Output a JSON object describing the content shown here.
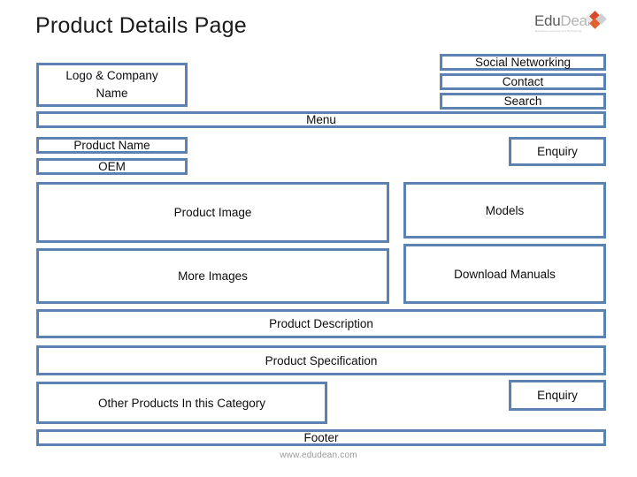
{
  "page": {
    "title": "Product Details Page",
    "footer_url": "www.edudean.com"
  },
  "brand": {
    "name_part1": "Edu",
    "name_part2": "Dean",
    "tagline": "Education Learning and Technology",
    "mark_colors": [
      "#e8e8e8",
      "#d64a2a",
      "#e2622f",
      "#cfcfcf"
    ]
  },
  "theme": {
    "box_border": "#5b82b0",
    "box_fill": "#ffffff",
    "text": "#0d0d0d",
    "muted_text": "#9a9a9a"
  },
  "header": {
    "logo_company_box": "Logo & Company Name",
    "logo_company_line1": "Logo & Company",
    "logo_company_line2": "Name",
    "social_networking": "Social Networking",
    "contact": "Contact",
    "search": "Search",
    "menu": "Menu"
  },
  "product": {
    "name": "Product Name",
    "oem": "OEM",
    "enquiry_top": "Enquiry",
    "product_image": "Product Image",
    "more_images": "More Images",
    "models": "Models",
    "download_manuals": "Download Manuals",
    "description": "Product Description",
    "specification": "Product Specification",
    "other_products": "Other Products In this Category",
    "enquiry_bottom": "Enquiry"
  },
  "footer": {
    "label": "Footer"
  }
}
